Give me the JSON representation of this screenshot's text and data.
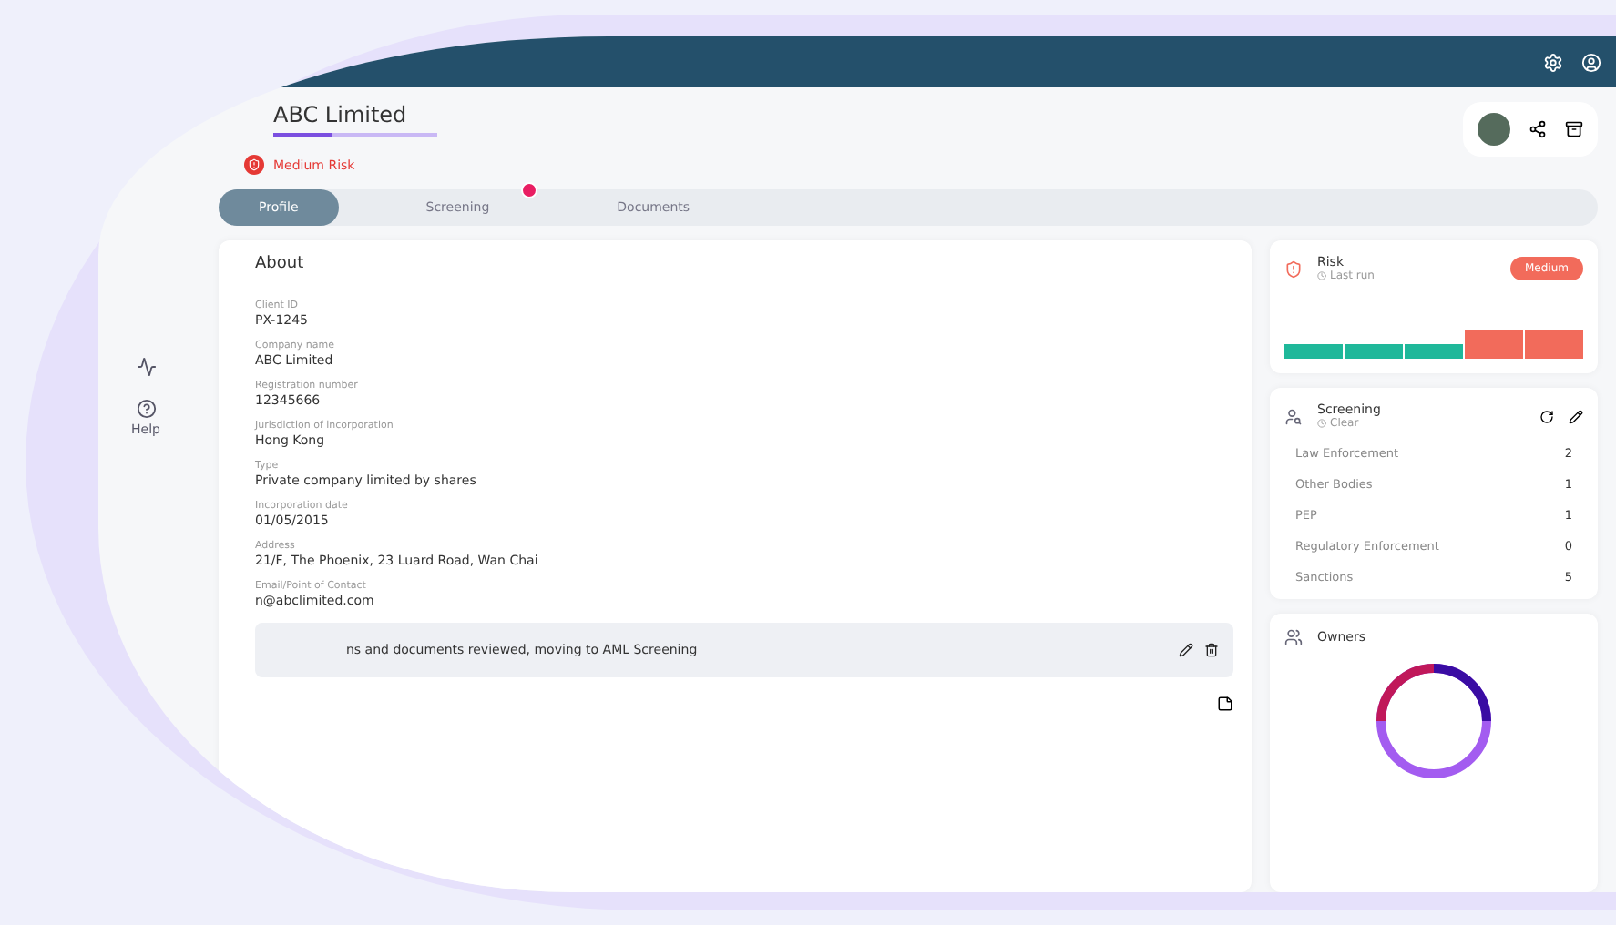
{
  "sidebar": {
    "help_label": "Help"
  },
  "entity": {
    "name": "ABC Limited",
    "progress": {
      "level": 0.35
    },
    "risk": "Medium Risk"
  },
  "tabs": [
    {
      "label": "Profile",
      "selected": true,
      "badge": false
    },
    {
      "label": "Screening",
      "selected": false,
      "badge": true
    },
    {
      "label": "Documents",
      "selected": false,
      "badge": false
    }
  ],
  "about": {
    "title": "About",
    "fields": [
      {
        "label": "Client ID",
        "value": "PX-1245"
      },
      {
        "label": "Company name",
        "value": "ABC Limited"
      },
      {
        "label": "Registration number",
        "value": "12345666"
      },
      {
        "label": "Jurisdiction of incorporation",
        "value": "Hong Kong"
      },
      {
        "label": "Type",
        "value": "Private company limited by shares"
      },
      {
        "label": "Incorporation date",
        "value": "01/05/2015"
      },
      {
        "label": "Address",
        "value": "21/F, The Phoenix, 23 Luard Road, Wan Chai"
      },
      {
        "label": "Email/Point of Contact",
        "value": "n@abclimited.com"
      }
    ],
    "note": "ns and documents reviewed, moving to AML Screening"
  },
  "risk_card": {
    "title": "Risk",
    "subtitle": "Last run",
    "badge": "Medium",
    "segments": [
      {
        "color": "#1fb89a"
      },
      {
        "color": "#1fb89a"
      },
      {
        "color": "#1fb89a"
      },
      {
        "color": "#f26b5b"
      },
      {
        "color": "#f26b5b"
      }
    ]
  },
  "screening_card": {
    "title": "Screening",
    "subtitle": "Clear",
    "rows": [
      {
        "label": "Law Enforcement",
        "count": "2"
      },
      {
        "label": "Other Bodies",
        "count": "1"
      },
      {
        "label": "PEP",
        "count": "1"
      },
      {
        "label": "Regulatory Enforcement",
        "count": "0"
      },
      {
        "label": "Sanctions",
        "count": "5"
      }
    ]
  },
  "owners_card": {
    "title": "Owners"
  }
}
